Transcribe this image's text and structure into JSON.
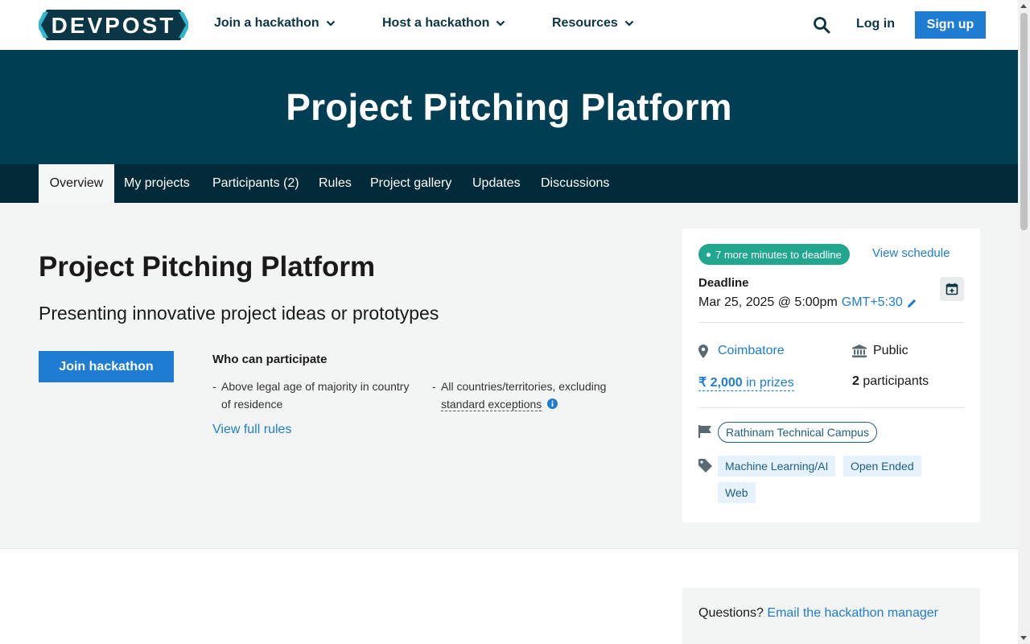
{
  "brand": {
    "logo_text": "DEVPOST"
  },
  "nav": {
    "items": [
      {
        "label": "Join a hackathon"
      },
      {
        "label": "Host a hackathon"
      },
      {
        "label": "Resources"
      }
    ],
    "login": "Log in",
    "signup": "Sign up"
  },
  "hero": {
    "title": "Project Pitching Platform"
  },
  "tabs": [
    {
      "label": "Overview",
      "active": true
    },
    {
      "label": "My projects"
    },
    {
      "label": "Participants (2)"
    },
    {
      "label": "Rules"
    },
    {
      "label": "Project gallery"
    },
    {
      "label": "Updates"
    },
    {
      "label": "Discussions"
    }
  ],
  "main": {
    "title": "Project Pitching Platform",
    "subtitle": "Presenting innovative project ideas or prototypes",
    "join_button": "Join hackathon",
    "who_title": "Who can participate",
    "eligibility": [
      {
        "dash": "-",
        "text_line1": "Above legal age of majority in country",
        "text_line2": "of residence"
      },
      {
        "dash": "-",
        "text_line1": "All countries/territories, excluding",
        "link": "standard exceptions"
      }
    ],
    "full_rules": "View full rules"
  },
  "sidebar": {
    "badge": "7 more minutes to deadline",
    "schedule": "View schedule",
    "deadline_label": "Deadline",
    "deadline_date": "Mar 25, 2025 @ 5:00pm",
    "timezone": "GMT+5:30",
    "location": "Coimbatore",
    "visibility": "Public",
    "prizes_amount": "₹ 2,000",
    "prizes_suffix": " in prizes",
    "participants_count": "2",
    "participants_label": " participants",
    "host": "Rathinam Technical Campus",
    "tags": [
      "Machine Learning/AI",
      "Open Ended",
      "Web"
    ]
  },
  "questions": {
    "prefix": "Questions? ",
    "link": "Email the hackathon manager"
  },
  "colors": {
    "hero_bg": "#003e54",
    "tabs_bg": "#022a38",
    "accent_blue": "#1e7dd3",
    "badge_green": "#21a68f"
  }
}
